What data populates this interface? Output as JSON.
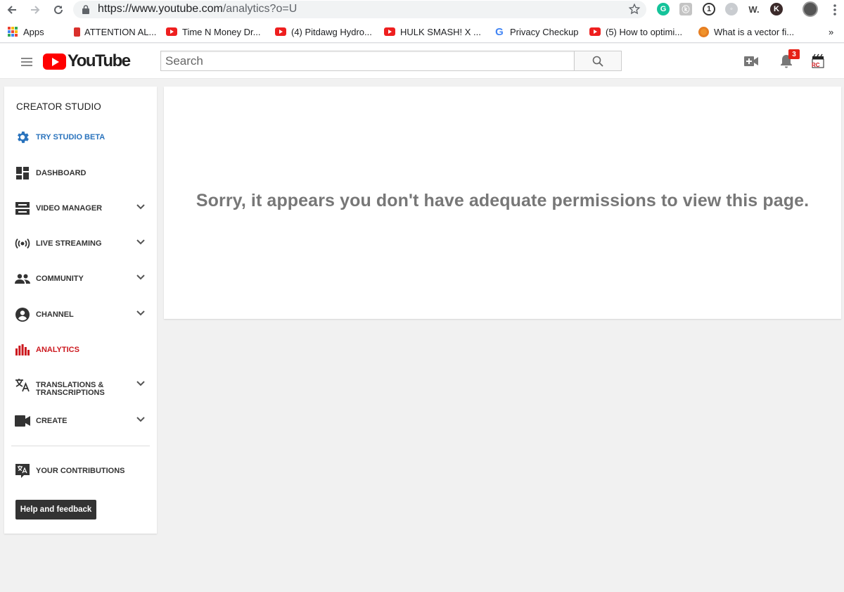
{
  "browser": {
    "url_host": "https://www.youtube.com",
    "url_path": "/analytics?o=U"
  },
  "bookmarks": {
    "items": [
      {
        "label": "Apps",
        "icon": "apps-grid-icon"
      },
      {
        "label": "ATTENTION AL...",
        "icon": "notepad-icon"
      },
      {
        "label": "Time N Money Dr...",
        "icon": "youtube-icon"
      },
      {
        "label": "(4) Pitdawg Hydro...",
        "icon": "youtube-icon"
      },
      {
        "label": "HULK SMASH! X ...",
        "icon": "youtube-icon"
      },
      {
        "label": "Privacy Checkup",
        "icon": "google-icon"
      },
      {
        "label": "(5) How to optimi...",
        "icon": "youtube-icon"
      },
      {
        "label": "What is a vector fi...",
        "icon": "vector-site-icon"
      }
    ],
    "overflow": "»"
  },
  "header": {
    "logo_text": "YouTube",
    "search_placeholder": "Search",
    "notification_count": "3",
    "avatar_text": "RC"
  },
  "sidebar": {
    "title": "CREATOR STUDIO",
    "items": [
      {
        "label": "TRY STUDIO BETA",
        "icon": "gear-icon"
      },
      {
        "label": "DASHBOARD",
        "icon": "dashboard-icon"
      },
      {
        "label": "VIDEO MANAGER",
        "icon": "video-manager-icon"
      },
      {
        "label": "LIVE STREAMING",
        "icon": "live-streaming-icon"
      },
      {
        "label": "COMMUNITY",
        "icon": "community-icon"
      },
      {
        "label": "CHANNEL",
        "icon": "channel-icon"
      },
      {
        "label": "ANALYTICS",
        "icon": "analytics-icon"
      },
      {
        "label": "TRANSLATIONS &",
        "label2": "TRANSCRIPTIONS",
        "icon": "translate-icon"
      },
      {
        "label": "CREATE",
        "icon": "camera-icon"
      },
      {
        "label": "YOUR CONTRIBUTIONS",
        "icon": "contributions-icon"
      }
    ],
    "help_label": "Help and feedback"
  },
  "main": {
    "message": "Sorry, it appears you don't have adequate permissions to view this page."
  },
  "colors": {
    "youtube_red": "#ff0000",
    "beta_blue": "#2a73bd",
    "active_red": "#cc181e",
    "message_gray": "#777777"
  }
}
